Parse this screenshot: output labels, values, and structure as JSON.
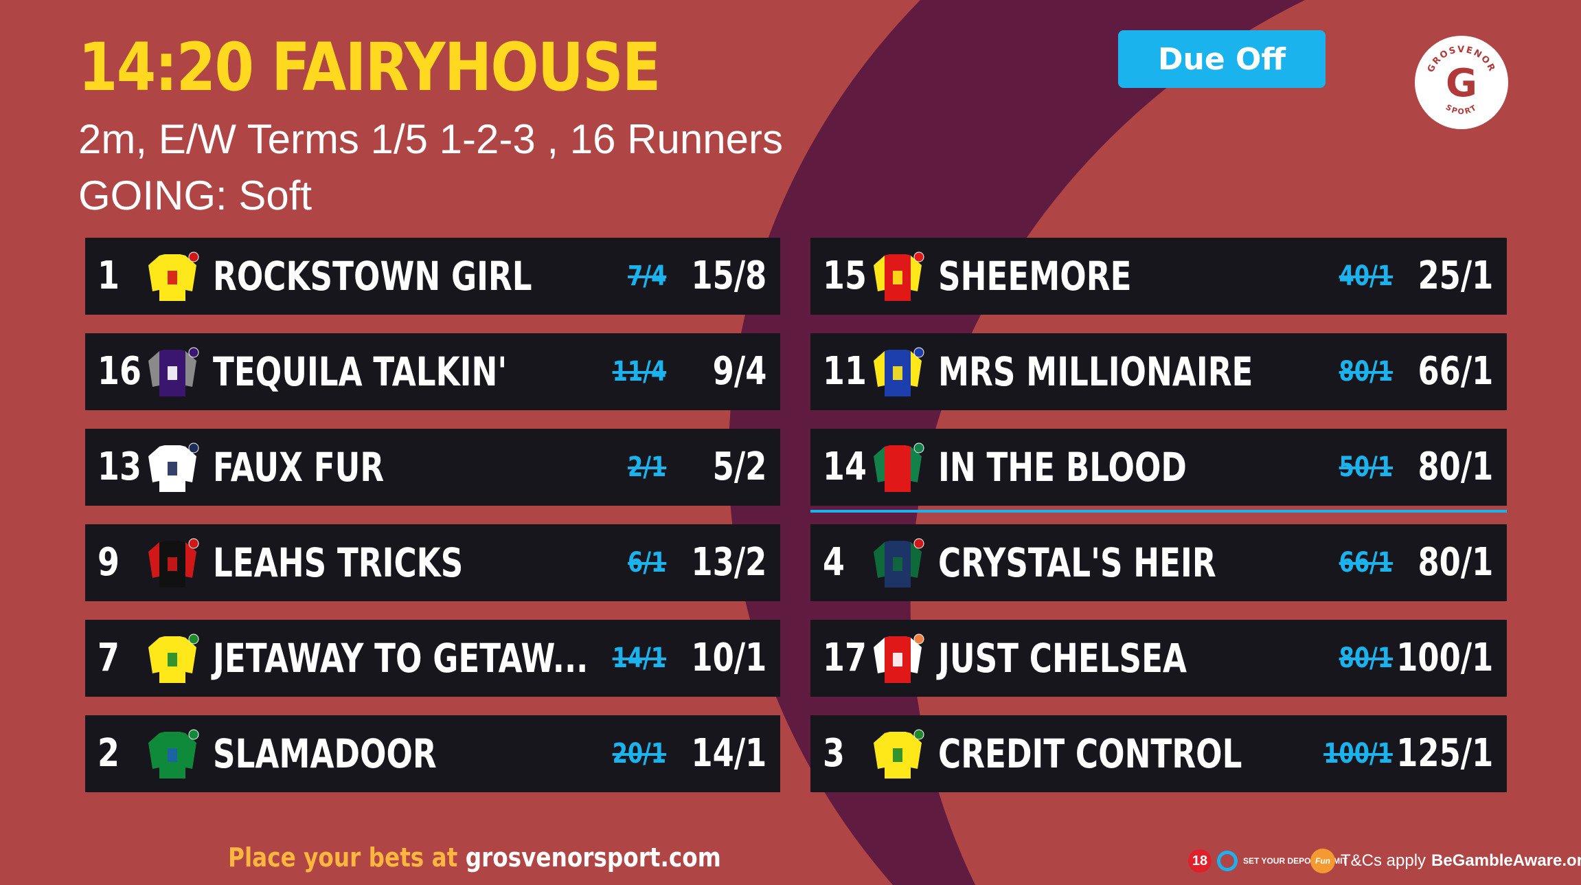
{
  "header": {
    "title": "14:20 FAIRYHOUSE",
    "terms_line": "2m,  E/W Terms 1/5 1-2-3 , 16 Runners",
    "going_line": "GOING: Soft",
    "status_label": "Due Off"
  },
  "logo": {
    "brand_top": "GROSVENOR",
    "brand_bottom": "SPORT",
    "letter": "G"
  },
  "runners_left": [
    {
      "number": "1",
      "name": "ROCKSTOWN GIRL",
      "old_odds": "7/4",
      "odds": "15/8",
      "silk": "silk-yellow-red-cap"
    },
    {
      "number": "16",
      "name": "TEQUILA TALKIN'",
      "old_odds": "11/4",
      "odds": "9/4",
      "silk": "silk-purple-star"
    },
    {
      "number": "13",
      "name": "FAUX FUR",
      "old_odds": "2/1",
      "odds": "5/2",
      "silk": "silk-white-cross"
    },
    {
      "number": "9",
      "name": "LEAHS TRICKS",
      "old_odds": "6/1",
      "odds": "13/2",
      "silk": "silk-black-red"
    },
    {
      "number": "7",
      "name": "JETAWAY TO GETAW...",
      "old_odds": "14/1",
      "odds": "10/1",
      "silk": "silk-yellow-green-stars"
    },
    {
      "number": "2",
      "name": "SLAMADOOR",
      "old_odds": "20/1",
      "odds": "14/1",
      "silk": "silk-green-blue"
    }
  ],
  "runners_right": [
    {
      "number": "15",
      "name": "SHEEMORE",
      "old_odds": "40/1",
      "odds": "25/1",
      "silk": "silk-red-yellow-quartered"
    },
    {
      "number": "11",
      "name": "MRS MILLIONAIRE",
      "old_odds": "80/1",
      "odds": "66/1",
      "silk": "silk-blue-yellow-check"
    },
    {
      "number": "14",
      "name": "IN THE BLOOD",
      "old_odds": "50/1",
      "odds": "80/1",
      "silk": "silk-red-green"
    },
    {
      "number": "4",
      "name": "CRYSTAL'S HEIR",
      "old_odds": "66/1",
      "odds": "80/1",
      "silk": "silk-navy-green"
    },
    {
      "number": "17",
      "name": "JUST CHELSEA",
      "old_odds": "80/1",
      "odds": "100/1",
      "silk": "silk-red-white"
    },
    {
      "number": "3",
      "name": "CREDIT CONTROL",
      "old_odds": "100/1",
      "odds": "125/1",
      "silk": "silk-yellow-green-spots"
    }
  ],
  "footer": {
    "cta_prefix": "Place your bets at",
    "cta_url": "grosvenorsport.com",
    "age_badge": "18",
    "deposit_limit": "SET YOUR DEPOSIT LIMIT",
    "keep_it_fun": "Fun",
    "tcs": "T&Cs apply",
    "gamble_aware": "BeGambleAware.org"
  },
  "colors": {
    "background": "#b04545",
    "arc": "#5f1b40",
    "title": "#ffd91f",
    "accent": "#1ab3ee",
    "row": "#17161c",
    "cta": "#ffb640"
  }
}
